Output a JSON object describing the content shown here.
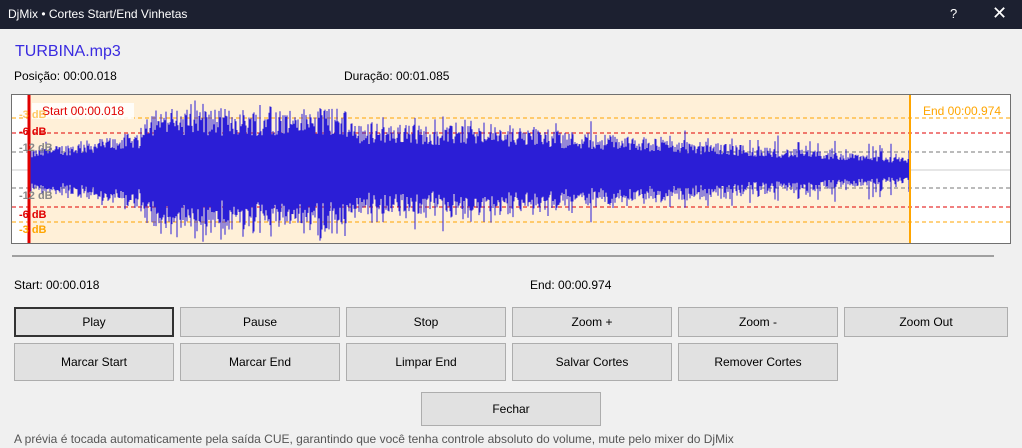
{
  "window": {
    "title": "DjMix • Cortes Start/End Vinhetas",
    "help": "?",
    "close": "✕"
  },
  "file_name": "TURBINA.mp3",
  "position": "Posição: 00:00.018",
  "duration": "Duração: 00:01.085",
  "waveform": {
    "start_label": "Start 00:00.018",
    "end_label": "End 00:00.974",
    "db_labels": [
      "-3 dB",
      "-6 dB",
      "-12 dB",
      "-12 dB",
      "-6 dB",
      "-3 dB"
    ],
    "start_fraction": 0.0166,
    "end_fraction": 0.8977,
    "colors": {
      "wave": "#2b1ed6",
      "selection": "#fff0d8",
      "start": "#e00000",
      "end": "#ffa500"
    }
  },
  "start_text": "Start: 00:00.018",
  "end_text": "End: 00:00.974",
  "buttons": {
    "play": "Play",
    "pause": "Pause",
    "stop": "Stop",
    "zoom_in": "Zoom +",
    "zoom_out_step": "Zoom -",
    "zoom_out": "Zoom Out",
    "mark_start": "Marcar Start",
    "mark_end": "Marcar End",
    "clear_end": "Limpar End",
    "save": "Salvar Cortes",
    "remove": "Remover Cortes",
    "close": "Fechar"
  },
  "footer": "A prévia é tocada automaticamente pela saída CUE, garantindo que você tenha controle absoluto do volume, mute  pelo mixer do DjMix"
}
